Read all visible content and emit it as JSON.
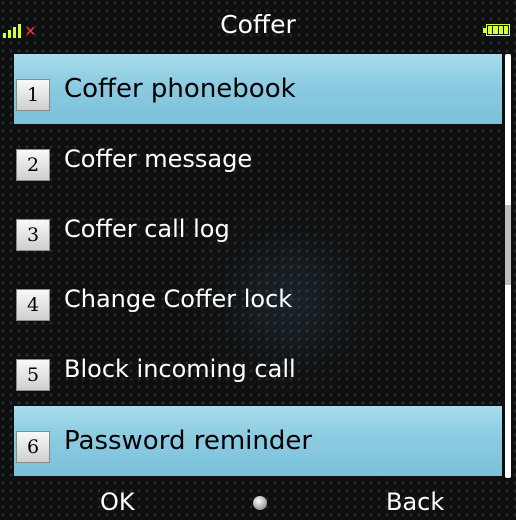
{
  "status_bar": {
    "title": "Coffer",
    "signal_icon": "signal-icon",
    "no_service_icon": "x-icon",
    "battery_icon": "battery-icon",
    "accent_color": "#d4ff3a"
  },
  "menu": {
    "selection_color": "#8ccbe1",
    "items": [
      {
        "number": "1",
        "label": "Coffer phonebook"
      },
      {
        "number": "2",
        "label": "Coffer message"
      },
      {
        "number": "3",
        "label": "Coffer call log"
      },
      {
        "number": "4",
        "label": "Change Coffer lock"
      },
      {
        "number": "5",
        "label": "Block incoming call"
      },
      {
        "number": "6",
        "label": "Password reminder"
      }
    ]
  },
  "softkeys": {
    "left": "OK",
    "center_icon": "center-dot-icon",
    "right": "Back"
  }
}
